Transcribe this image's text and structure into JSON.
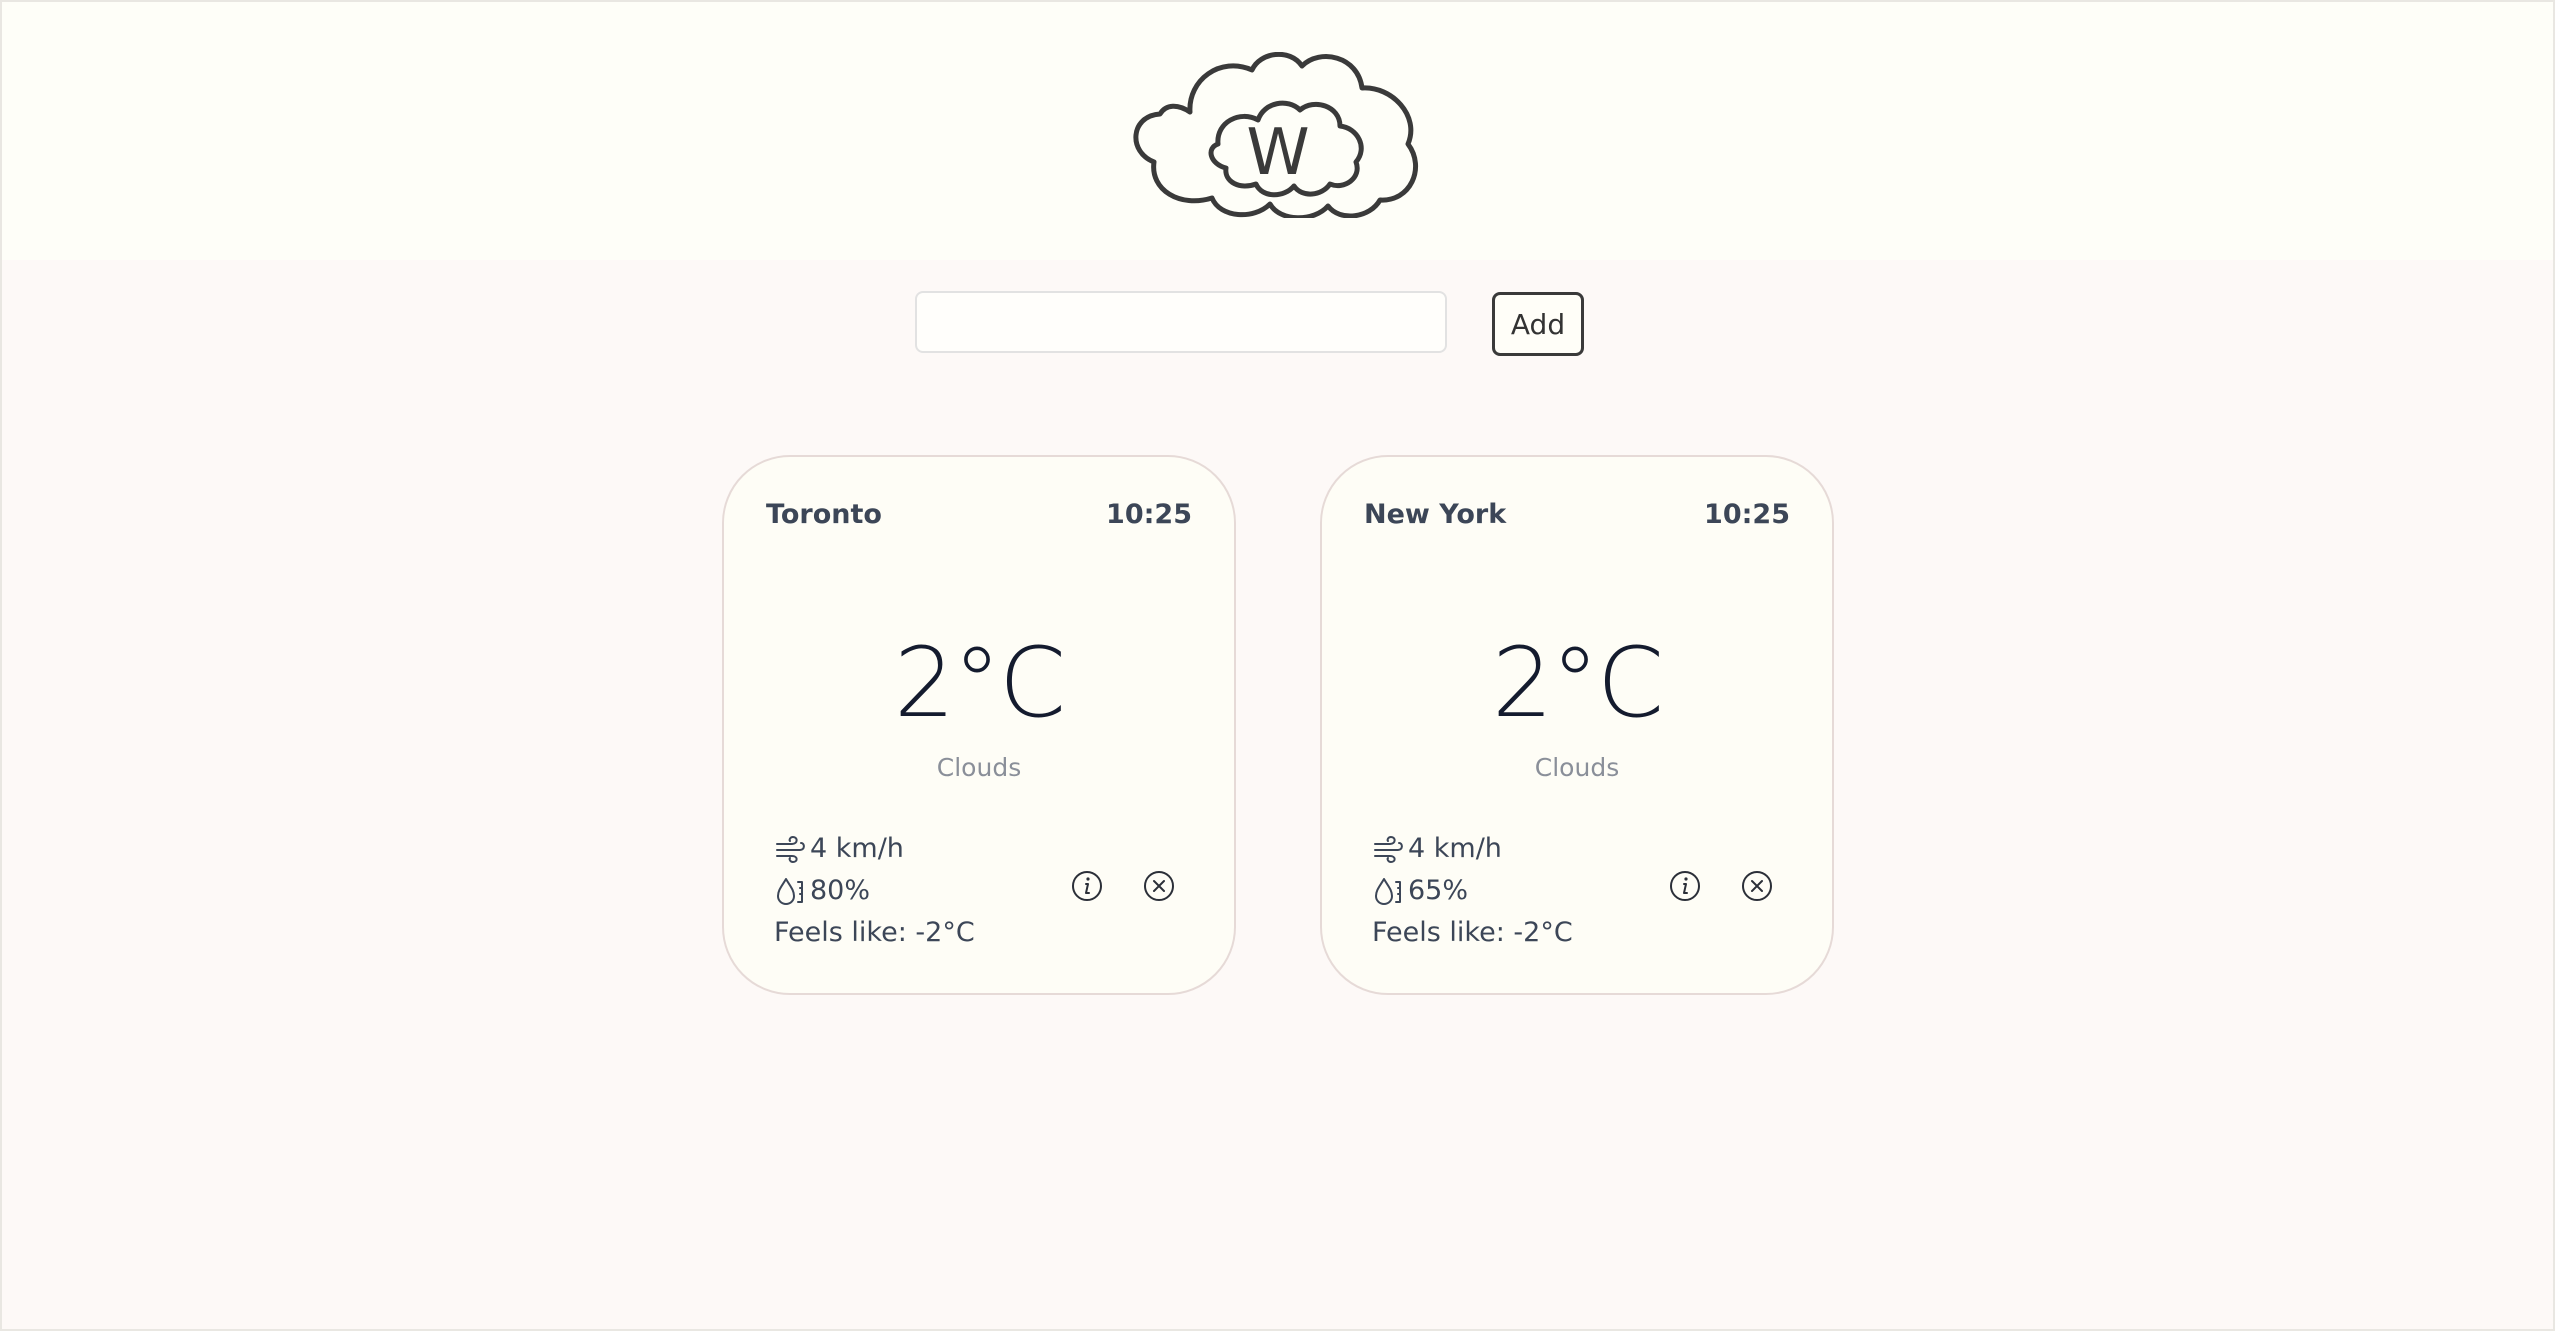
{
  "search": {
    "value": "",
    "placeholder": ""
  },
  "toolbar": {
    "add_label": "Add"
  },
  "logo": {
    "letter": "W",
    "icon": "cloud-logo-icon"
  },
  "cards": [
    {
      "city": "Toronto",
      "time": "10:25",
      "temperature": "2°C",
      "condition": "Clouds",
      "wind": "4 km/h",
      "humidity": "80%",
      "feels_like": "Feels like: -2°C"
    },
    {
      "city": "New York",
      "time": "10:25",
      "temperature": "2°C",
      "condition": "Clouds",
      "wind": "4 km/h",
      "humidity": "65%",
      "feels_like": "Feels like: -2°C"
    }
  ],
  "icons": {
    "wind": "wind-icon",
    "humidity": "humidity-icon",
    "info": "info-icon",
    "close": "close-icon"
  },
  "colors": {
    "header_bg": "#fefef8",
    "page_bg": "#fdf9f7",
    "card_bg": "#fefdf6",
    "card_border": "#e6dad7",
    "temperature_text": "#141b2e",
    "muted_text": "#8a8f99"
  }
}
